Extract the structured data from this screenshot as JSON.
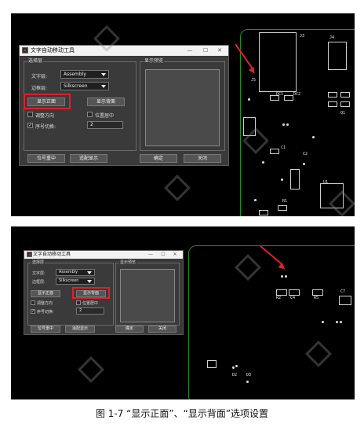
{
  "shot1": {
    "dialog": {
      "title": "文字自动移动工具",
      "win_min": "—",
      "win_max": "☐",
      "win_close": "✕",
      "group_select": "选择层",
      "text_layer_label": "文字层:",
      "text_layer_value": "Assembly",
      "edge_layer_label": "边框层:",
      "edge_layer_value": "Silkscreen",
      "btn_show_front": "显示正面",
      "btn_show_back": "显示背面",
      "chk_adjust_dir": "调整方向",
      "chk_center": "位置居中",
      "chk_seq_switch": "序号切换:",
      "seq_value": "2",
      "group_preview": "显示预览",
      "btn_seq_center": "位号重中",
      "btn_match_display": "适配显示",
      "btn_confirm": "确定",
      "btn_close": "关闭"
    },
    "labels": [
      "J5",
      "J3",
      "J4",
      "DC1",
      "DC2",
      "Q1",
      "C1",
      "U1",
      "R1",
      "C2"
    ]
  },
  "shot2": {
    "dialog": {
      "title": "文字自动移动工具",
      "win_min": "—",
      "win_max": "☐",
      "win_close": "✕",
      "group_select": "选择层",
      "text_layer_label": "文字层:",
      "text_layer_value": "Assembly",
      "edge_layer_label": "边框层:",
      "edge_layer_value": "Silkscreen",
      "btn_show_front": "显示正面",
      "btn_show_back": "显示背面",
      "chk_adjust_dir": "调整方向",
      "chk_center": "位置居中",
      "chk_seq_switch": "序号切换:",
      "seq_value": "2",
      "group_preview": "显示预览",
      "btn_seq_center": "位号重中",
      "btn_match_display": "适配显示",
      "btn_confirm": "确定",
      "btn_close": "关闭"
    },
    "labels": [
      "R2",
      "C4",
      "R5",
      "C7",
      "D2",
      "D3"
    ]
  },
  "caption": "图 1-7 “显示正面”、“显示背面”选项设置",
  "colors": {
    "highlight": "#e0202c",
    "pcb_outline": "#2a8a2a",
    "dialog_bg": "#3a3a3a"
  }
}
